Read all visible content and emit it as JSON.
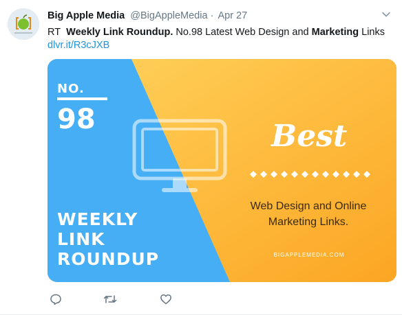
{
  "tweet": {
    "author_name": "Big Apple Media",
    "handle": "@BigAppleMedia",
    "separator": "·",
    "time": "Apr 27",
    "text_prefix": "RT",
    "text_bold_1": "Weekly Link Roundup.",
    "text_middle": "No.98 Latest Web Design and",
    "text_bold_2": "Marketing",
    "text_suffix": "Links",
    "link": "dlvr.it/R3cJXB"
  },
  "card": {
    "no_label": "NO.",
    "number": "98",
    "weekly_lines": [
      "WEEKLY",
      "LINK",
      "ROUNDUP"
    ],
    "best": "Best",
    "subtitle_lines": [
      "Web Design and Online",
      "Marketing Links."
    ],
    "site": "BIGAPPLEMEDIA.COM"
  },
  "colors": {
    "blue": "#45aef5",
    "orange_light": "#ffd15a",
    "orange_dark": "#fca623",
    "link": "#1b95e0",
    "muted": "#657786"
  },
  "icons": {
    "caret": "chevron-down-icon",
    "reply": "reply-icon",
    "retweet": "retweet-icon",
    "like": "heart-icon"
  }
}
